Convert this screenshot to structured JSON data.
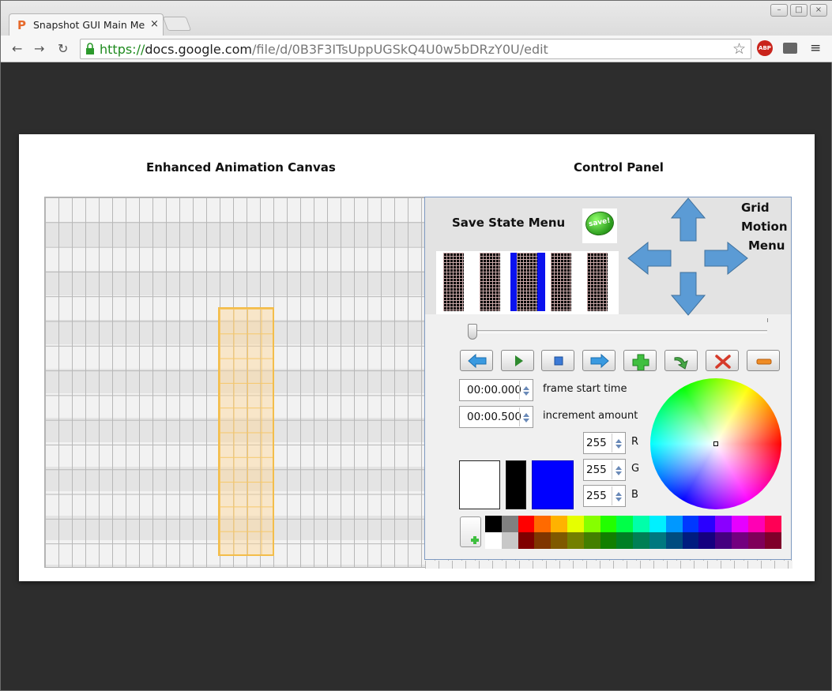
{
  "browser": {
    "tab_title": "Snapshot GUI Main Me",
    "tab_close": "×",
    "url_scheme": "https://",
    "url_host": "docs.google.com",
    "url_path": "/file/d/0B3F3ITsUppUGSkQ4U0w5bDRzY0U/edit",
    "extension_label": "ABP"
  },
  "document": {
    "canvas_heading": "Enhanced Animation Canvas",
    "panel_heading": "Control Panel",
    "save_state_label": "Save State Menu",
    "save_button_text": "save!",
    "grid_motion_label": [
      "Grid",
      "Motion",
      "Menu"
    ]
  },
  "controls": {
    "frame_start_value": "00:00.000",
    "frame_start_label": "frame start time",
    "increment_value": "00:00.500",
    "increment_label": "increment amount",
    "rgb": [
      {
        "value": "255",
        "label": "R"
      },
      {
        "value": "255",
        "label": "G"
      },
      {
        "value": "255",
        "label": "B"
      }
    ]
  },
  "colors": {
    "primary_swatch": "#ffffff",
    "secondary_swatch": "#000000",
    "tertiary_swatch": "#0000ff",
    "arrow": "#5b9bd5",
    "selection": "#f3bd4a",
    "palette_top": [
      "#000000",
      "#808080",
      "#ff0000",
      "#ff6a00",
      "#ffb200",
      "#e6ff00",
      "#86ff00",
      "#22ff00",
      "#00ff48",
      "#00ffaa",
      "#00f0ff",
      "#0098ff",
      "#0038ff",
      "#2a00ff",
      "#8a00ff",
      "#e600ff",
      "#ff00b4",
      "#ff0055"
    ],
    "palette_bottom": [
      "#ffffff",
      "#c8c8c8",
      "#7f0000",
      "#7f3500",
      "#7f5900",
      "#737f00",
      "#437f00",
      "#117f00",
      "#007f24",
      "#007f55",
      "#00787f",
      "#004c7f",
      "#001c7f",
      "#15007f",
      "#45007f",
      "#73007f",
      "#7f005a",
      "#7f002a"
    ]
  }
}
